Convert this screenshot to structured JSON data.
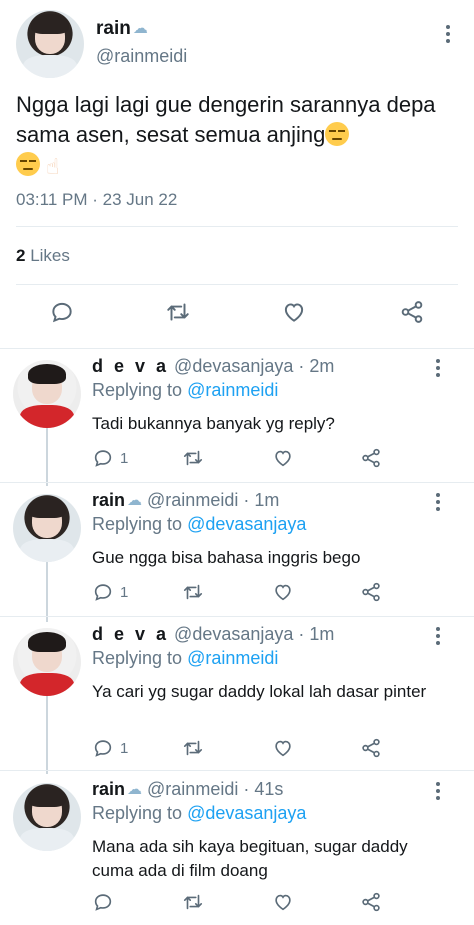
{
  "main_tweet": {
    "name": "rain",
    "handle": "@rainmeidi",
    "text": "Ngga lagi lagi gue dengerin sarannya depa sama asen, sesat semua anjing",
    "time": "03:11 PM · 23 Jun 22",
    "likes_count": "2",
    "likes_label": " Likes"
  },
  "replies": [
    {
      "name": "d e v a",
      "handle": "@devasanjaya",
      "time": "· 2m",
      "replying_label": "Replying to ",
      "replying_to": "@rainmeidi",
      "text": "Tadi bukannya banyak yg reply?",
      "reply_count": "1"
    },
    {
      "name": "rain",
      "handle": "@rainmeidi",
      "time": "· 1m",
      "replying_label": "Replying to ",
      "replying_to": "@devasanjaya",
      "text": "Gue ngga bisa bahasa inggris bego",
      "reply_count": "1"
    },
    {
      "name": "d e v a",
      "handle": "@devasanjaya",
      "time": "· 1m",
      "replying_label": "Replying to ",
      "replying_to": "@rainmeidi",
      "text": "Ya cari yg sugar daddy lokal lah dasar pinter",
      "reply_count": "1"
    },
    {
      "name": "rain",
      "handle": "@rainmeidi",
      "time": "· 41s",
      "replying_label": "Replying to ",
      "replying_to": "@devasanjaya",
      "text": "Mana ada sih kaya begituan, sugar daddy cuma ada di film doang",
      "reply_count": ""
    }
  ],
  "icons": {
    "reply": "reply-icon",
    "retweet": "retweet-icon",
    "like": "heart-icon",
    "share": "share-icon",
    "more": "more-options-icon",
    "weather": "cloud-rain-icon",
    "unamused": "unamused-face-emoji",
    "hand": "pointing-up-hand-emoji"
  },
  "colors": {
    "accent": "#1da1f2",
    "secondary_text": "#657786",
    "divider": "#e6ecf0"
  }
}
